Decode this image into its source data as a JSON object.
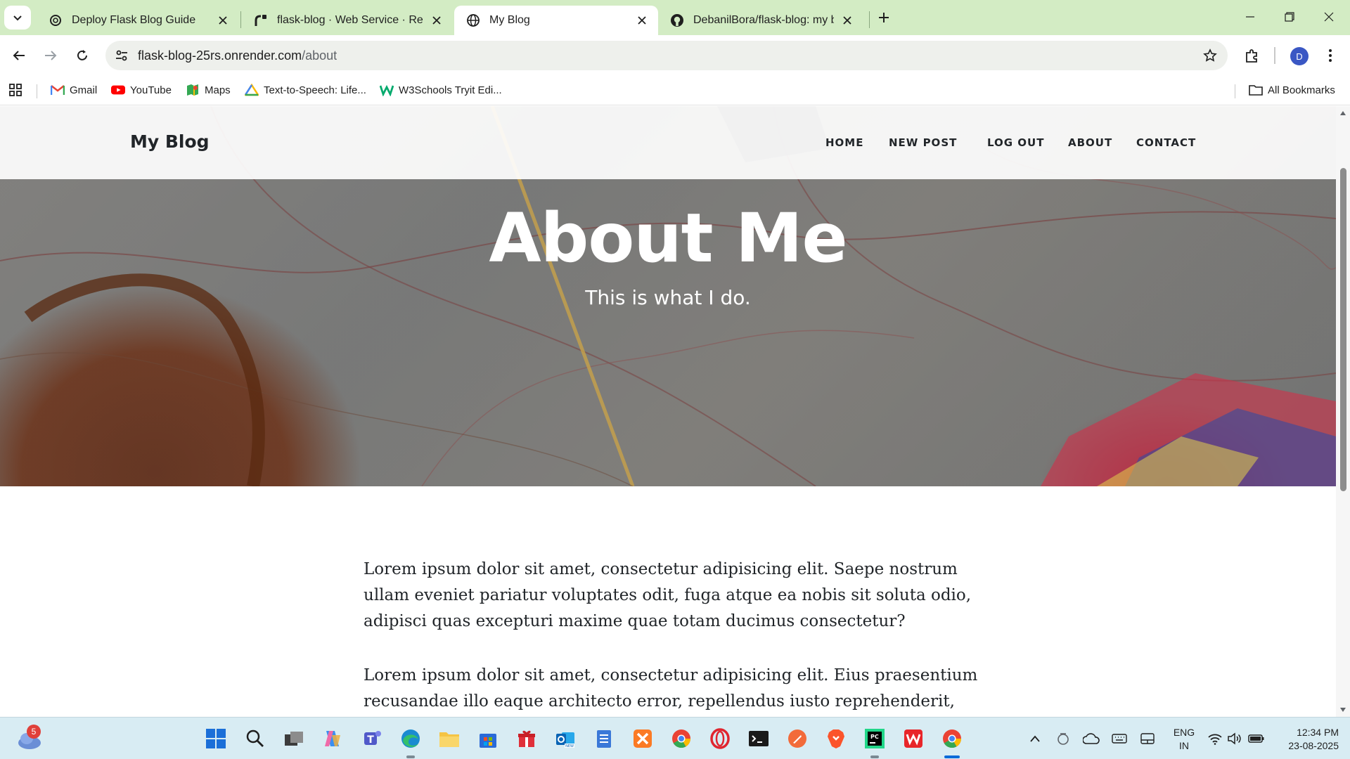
{
  "browser": {
    "tabs": [
      {
        "title": "Deploy Flask Blog Guide",
        "favicon": "openai-icon",
        "active": false
      },
      {
        "title": "flask-blog · Web Service · Render",
        "favicon": "render-icon",
        "active": false
      },
      {
        "title": "My Blog",
        "favicon": "globe-icon",
        "active": true
      },
      {
        "title": "DebanilBora/flask-blog: my blog",
        "favicon": "github-icon",
        "active": false
      }
    ],
    "url_host": "flask-blog-25rs.onrender.com",
    "url_path": "/about",
    "profile_initial": "D",
    "bookmarks": [
      {
        "label": "Gmail",
        "icon": "gmail-icon"
      },
      {
        "label": "YouTube",
        "icon": "youtube-icon"
      },
      {
        "label": "Maps",
        "icon": "maps-icon"
      },
      {
        "label": "Text-to-Speech: Life...",
        "icon": "tts-icon"
      },
      {
        "label": "W3Schools Tryit Edi...",
        "icon": "w3schools-icon"
      }
    ],
    "all_bookmarks_label": "All Bookmarks"
  },
  "site": {
    "brand": "My Blog",
    "nav": [
      "HOME",
      "NEW POST",
      "LOG OUT",
      "ABOUT",
      "CONTACT"
    ],
    "hero_title": "About Me",
    "hero_subtitle": "This is what I do.",
    "paragraphs": [
      "Lorem ipsum dolor sit amet, consectetur adipisicing elit. Saepe nostrum ullam eveniet pariatur voluptates odit, fuga atque ea nobis sit soluta odio, adipisci quas excepturi maxime quae totam ducimus consectetur?",
      "Lorem ipsum dolor sit amet, consectetur adipisicing elit. Eius praesentium recusandae illo eaque architecto error, repellendus iusto reprehenderit, dolorum quos itaque nostrum ad ratione odit tempore minima provident quaerat."
    ]
  },
  "taskbar": {
    "weather_badge": "5",
    "apps": [
      "start-icon",
      "search-icon",
      "task-view-icon",
      "copilot-icon",
      "teams-icon",
      "edge-icon",
      "file-explorer-icon",
      "store-icon",
      "gift-icon",
      "outlook-icon",
      "notepad-icon",
      "xampp-icon",
      "chrome-icon",
      "opera-icon",
      "terminal-icon",
      "postman-icon",
      "brave-icon",
      "pycharm-icon",
      "wps-icon",
      "chrome-active-icon"
    ],
    "language_top": "ENG",
    "language_bottom": "IN",
    "time": "12:34 PM",
    "date": "23-08-2025"
  },
  "colors": {
    "tabstrip": "#d3ecc4",
    "taskbar": "#d8ecf3",
    "hero_overlay": "#282830"
  }
}
